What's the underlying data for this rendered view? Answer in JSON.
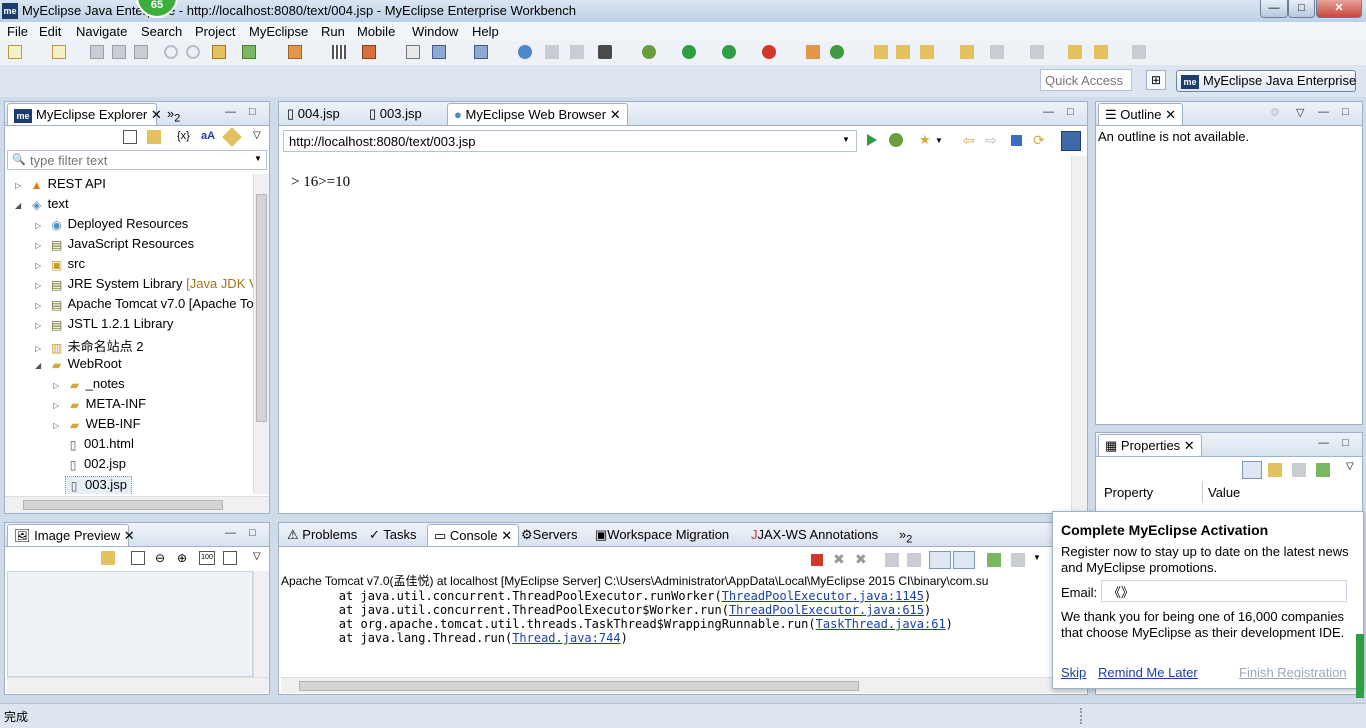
{
  "window": {
    "title": "MyEclipse Java Enterprise - http://localhost:8080/text/004.jsp - MyEclipse Enterprise Workbench",
    "app_icon": "me",
    "badge": "65",
    "minimize": "—",
    "maximize": "□",
    "close": "✕"
  },
  "menu": [
    "File",
    "Edit",
    "Navigate",
    "Search",
    "Project",
    "MyEclipse",
    "Run",
    "Mobile",
    "Window",
    "Help"
  ],
  "quick_access": {
    "placeholder": "Quick Access"
  },
  "perspective": {
    "label": "MyEclipse Java Enterprise",
    "logo": "me"
  },
  "explorer": {
    "tab_label": "MyEclipse Explorer",
    "overflow": "2",
    "filter_placeholder": "type filter text",
    "tree": [
      {
        "label": "REST API",
        "suffix": "",
        "icon": "rest-icon"
      },
      {
        "label": "text",
        "suffix": "",
        "icon": "project-icon"
      },
      {
        "label": "Deployed Resources",
        "suffix": "",
        "icon": "deployed-icon"
      },
      {
        "label": "JavaScript Resources",
        "suffix": "",
        "icon": "library-icon"
      },
      {
        "label": "src",
        "suffix": "",
        "icon": "source-folder-icon"
      },
      {
        "label": "JRE System Library",
        "suffix": "[Java JDK VI",
        "icon": "library-icon"
      },
      {
        "label": "Apache Tomcat v7.0 [Apache To",
        "suffix": "",
        "icon": "library-icon"
      },
      {
        "label": "JSTL 1.2.1 Library",
        "suffix": "",
        "icon": "library-icon"
      },
      {
        "label": "未命名站点 2",
        "suffix": "",
        "icon": "site-icon"
      },
      {
        "label": "WebRoot",
        "suffix": "",
        "icon": "folder-icon"
      },
      {
        "label": "_notes",
        "suffix": "",
        "icon": "folder-icon"
      },
      {
        "label": "META-INF",
        "suffix": "",
        "icon": "folder-icon"
      },
      {
        "label": "WEB-INF",
        "suffix": "",
        "icon": "folder-icon"
      },
      {
        "label": "001.html",
        "suffix": "",
        "icon": "html-file-icon"
      },
      {
        "label": "002.jsp",
        "suffix": "",
        "icon": "jsp-file-icon"
      },
      {
        "label": "003.jsp",
        "suffix": "",
        "icon": "jsp-file-icon"
      }
    ]
  },
  "image_preview": {
    "tab_label": "Image Preview"
  },
  "editor": {
    "tabs": [
      {
        "label": "004.jsp",
        "active": false
      },
      {
        "label": "003.jsp",
        "active": false
      },
      {
        "label": "MyEclipse Web Browser",
        "active": true
      }
    ],
    "url": "http://localhost:8080/text/003.jsp",
    "content": "> 16>=10"
  },
  "outline": {
    "tab_label": "Outline",
    "message": "An outline is not available."
  },
  "properties": {
    "tab_label": "Properties",
    "col_property": "Property",
    "col_value": "Value"
  },
  "console": {
    "tabs": [
      "Problems",
      "Tasks",
      "Console",
      "Servers",
      "Workspace Migration",
      "JAX-WS Annotations"
    ],
    "overflow": "2",
    "header": "Apache Tomcat v7.0(孟佳悦) at localhost [MyEclipse Server] C:\\Users\\Administrator\\AppData\\Local\\MyEclipse 2015 CI\\binary\\com.su",
    "lines": [
      {
        "prefix": "        at java.util.concurrent.ThreadPoolExecutor.runWorker(",
        "link": "ThreadPoolExecutor.java:1145",
        "suffix": ")"
      },
      {
        "prefix": "        at java.util.concurrent.ThreadPoolExecutor$Worker.run(",
        "link": "ThreadPoolExecutor.java:615",
        "suffix": ")"
      },
      {
        "prefix": "        at org.apache.tomcat.util.threads.TaskThread$WrappingRunnable.run(",
        "link": "TaskThread.java:61",
        "suffix": ")"
      },
      {
        "prefix": "        at java.lang.Thread.run(",
        "link": "Thread.java:744",
        "suffix": ")"
      }
    ]
  },
  "activation": {
    "title": "Complete MyEclipse Activation",
    "body": "Register now to stay up to date on the latest news and MyEclipse promotions.",
    "email_label": "Email:",
    "email_value": "《》",
    "thanks": "We thank you for being one of 16,000 companies that choose MyEclipse as their development IDE.",
    "skip": "Skip",
    "remind": "Remind Me Later",
    "finish": "Finish Registration"
  },
  "status": {
    "text": "完成"
  },
  "colors": {
    "accent": "#1a3fa8",
    "badge": "#3cae3c",
    "link_disabled": "#9aa8c0"
  }
}
